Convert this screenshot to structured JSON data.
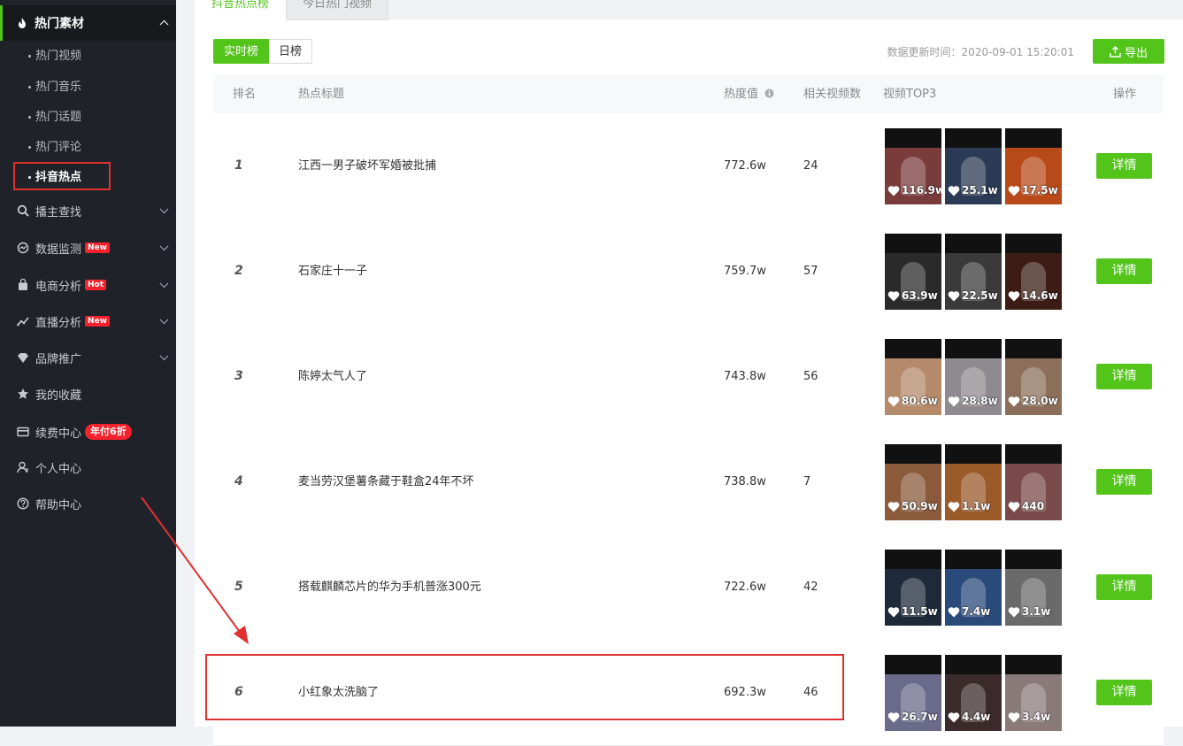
{
  "sidebar": {
    "group": {
      "label": "热门素材"
    },
    "sub_items": [
      "热门视频",
      "热门音乐",
      "热门话题",
      "热门评论",
      "抖音热点"
    ],
    "items": [
      {
        "label": "播主查找",
        "icon": "search-icon"
      },
      {
        "label": "数据监测",
        "icon": "monitor-icon",
        "tag": "New"
      },
      {
        "label": "电商分析",
        "icon": "shopping-bag-icon",
        "tag": "Hot"
      },
      {
        "label": "直播分析",
        "icon": "trend-icon",
        "tag": "New"
      },
      {
        "label": "品牌推广",
        "icon": "diamond-icon"
      },
      {
        "label": "我的收藏",
        "icon": "star-icon"
      },
      {
        "label": "续费中心",
        "icon": "card-icon",
        "tag": "年付6折"
      },
      {
        "label": "个人中心",
        "icon": "user-icon"
      },
      {
        "label": "帮助中心",
        "icon": "help-icon"
      }
    ]
  },
  "tabs": [
    "抖音热点榜",
    "今日热门视频"
  ],
  "toolbar": {
    "realtime_label": "实时榜",
    "daily_label": "日榜",
    "update_time": "数据更新时间：2020-09-01 15:20:01",
    "export_label": "导出"
  },
  "table": {
    "headers": [
      "排名",
      "热点标题",
      "热度值",
      "相关视频数",
      "视频TOP3",
      "操作"
    ],
    "detail_label": "详情",
    "rows": [
      {
        "rank": "1",
        "title": "江西一男子破坏军婚被批捕",
        "heat": "772.6w",
        "videos": "24",
        "likes": [
          "116.9w",
          "25.1w",
          "17.5w"
        ]
      },
      {
        "rank": "2",
        "title": "石家庄十一子",
        "heat": "759.7w",
        "videos": "57",
        "likes": [
          "63.9w",
          "22.5w",
          "14.6w"
        ]
      },
      {
        "rank": "3",
        "title": "陈婷太气人了",
        "heat": "743.8w",
        "videos": "56",
        "likes": [
          "80.6w",
          "28.8w",
          "28.0w"
        ]
      },
      {
        "rank": "4",
        "title": "麦当劳汉堡薯条藏于鞋盒24年不坏",
        "heat": "738.8w",
        "videos": "7",
        "likes": [
          "50.9w",
          "1.1w",
          "440"
        ]
      },
      {
        "rank": "5",
        "title": "搭载麒麟芯片的华为手机普涨300元",
        "heat": "722.6w",
        "videos": "42",
        "likes": [
          "11.5w",
          "7.4w",
          "3.1w"
        ]
      },
      {
        "rank": "6",
        "title": "小红象太洗脑了",
        "heat": "692.3w",
        "videos": "46",
        "likes": [
          "26.7w",
          "4.4w",
          "3.4w"
        ]
      }
    ]
  },
  "colors": {
    "accent": "#52c41a",
    "highlight": "#e03030",
    "sidebar_bg": "#1f2329"
  }
}
